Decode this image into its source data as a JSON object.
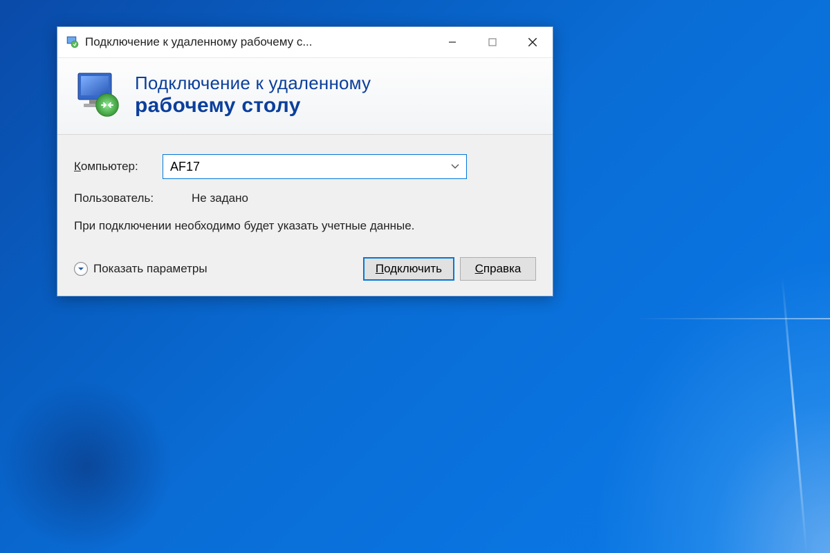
{
  "window": {
    "title": "Подключение к удаленному рабочему с..."
  },
  "header": {
    "line1": "Подключение к удаленному",
    "line2": "рабочему столу"
  },
  "form": {
    "computer_label_prefix": "К",
    "computer_label_rest": "омпьютер:",
    "computer_value": "AF17",
    "user_label": "Пользователь:",
    "user_value": "Не задано",
    "info_text": "При подключении необходимо будет указать учетные данные."
  },
  "footer": {
    "show_options_prefix": "П",
    "show_options_rest": "оказать параметры",
    "connect_prefix": "П",
    "connect_rest": "одключить",
    "help_prefix": "С",
    "help_rest": "правка"
  }
}
